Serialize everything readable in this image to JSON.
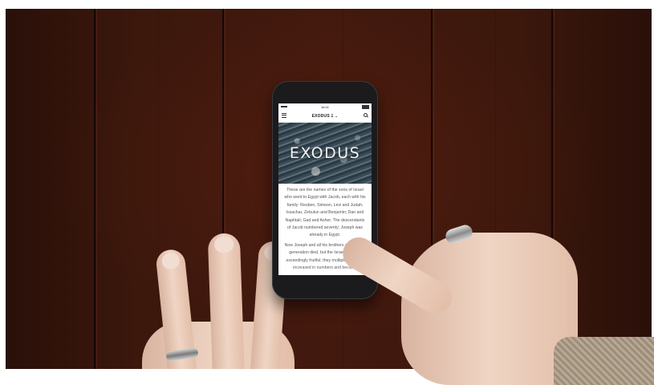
{
  "phone": {
    "status_time": "16:41",
    "nav_title": "EXODUS 1 ⌄",
    "hero_title": "EXODUS",
    "paragraphs": [
      "These are the names of the sons of Israel who went to Egypt with Jacob, each with his family: Reuben, Simeon, Levi and Judah; Issachar, Zebulun and Benjamin; Dan and Naphtali; Gad and Asher. The descendants of Jacob numbered seventy; Joseph was already in Egypt.",
      "Now Joseph and all his brothers and all that generation died, but the Israelites were exceedingly fruitful; they multiplied greatly, increased in numbers and became"
    ]
  },
  "colors": {
    "wood": "#3b170c",
    "phone_body": "#1b1b1d",
    "screen_bg": "#ffffff",
    "skin": "#f0d5c4"
  },
  "icons": {
    "menu": "hamburger-menu-icon",
    "search": "search-icon"
  }
}
